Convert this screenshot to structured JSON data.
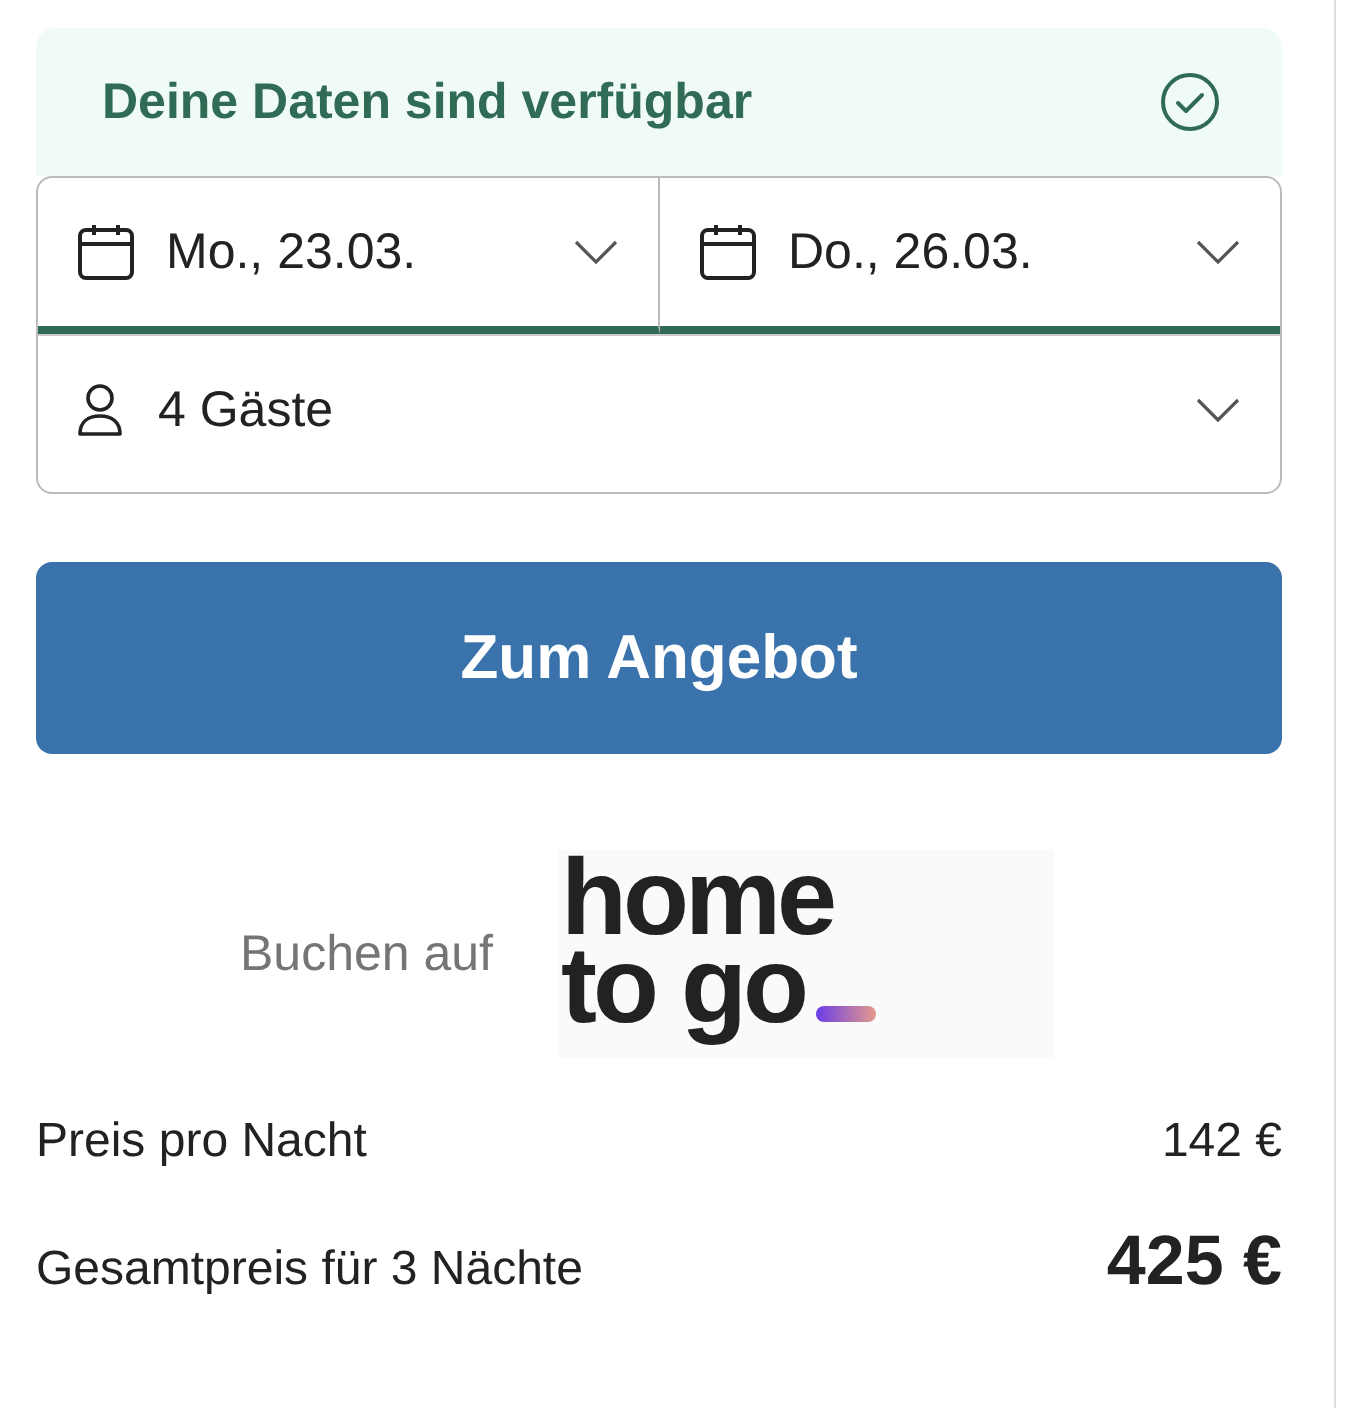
{
  "availability": {
    "message": "Deine Daten sind verfügbar",
    "available": true
  },
  "fields": [
    {
      "kind": "date",
      "value": "Mo., 23.03.",
      "confirmed": true
    },
    {
      "kind": "date",
      "value": "Do., 26.03.",
      "confirmed": true
    },
    {
      "kind": "guests",
      "value": "4 Gäste",
      "confirmed": false
    }
  ],
  "cta_button": "Zum Angebot",
  "provider": {
    "label": "Buchen auf",
    "logo_lines": [
      "home",
      "to go"
    ]
  },
  "prices": [
    {
      "label": "Preis pro Nacht",
      "amount": "142 €",
      "kind": "regular"
    },
    {
      "label": "Gesamtpreis für 3 Nächte",
      "amount": "425 €",
      "kind": "total"
    }
  ]
}
